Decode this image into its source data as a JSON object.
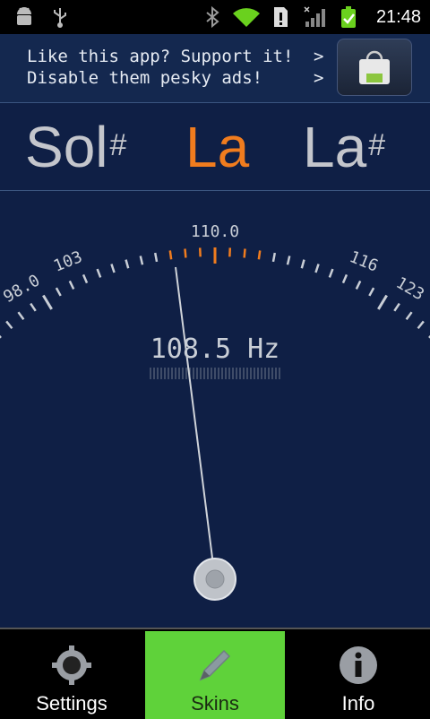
{
  "status_bar": {
    "time": "21:48",
    "icons": [
      "android-debug-icon",
      "usb-icon",
      "bluetooth-icon",
      "wifi-icon",
      "sd-card-warning-icon",
      "signal-icon",
      "battery-charging-icon"
    ]
  },
  "ad": {
    "line1": "Like this app? Support it!",
    "line2": "Disable them pesky ads!",
    "arrow": ">",
    "icon": "market-bag-icon"
  },
  "notes": {
    "left": {
      "name": "Sol",
      "accidental": "#"
    },
    "center": {
      "name": "La",
      "accidental": ""
    },
    "right": {
      "name": "La",
      "accidental": "#"
    }
  },
  "gauge": {
    "labels": {
      "far_left": "98.0",
      "left": "103",
      "center": "110.0",
      "right": "116",
      "far_right": "123"
    },
    "frequency": "108.5 Hz"
  },
  "tabs": [
    {
      "label": "Settings",
      "icon": "gear-icon",
      "active": false
    },
    {
      "label": "Skins",
      "icon": "pencil-icon",
      "active": true
    },
    {
      "label": "Info",
      "icon": "info-icon",
      "active": false
    }
  ],
  "colors": {
    "background": "#0f1f45",
    "accent_orange": "#f07c1e",
    "inactive_note": "#c4c6cc",
    "active_tab": "#5fd23a"
  }
}
